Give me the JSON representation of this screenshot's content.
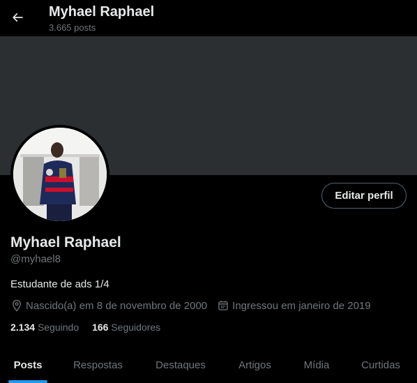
{
  "header": {
    "title": "Myhael Raphael",
    "posts_count": "3.665 posts",
    "back_icon": "arrow-left-icon"
  },
  "profile": {
    "name": "Myhael Raphael",
    "handle": "@myhael8",
    "bio": "Estudante de ads 1/4",
    "birth": "Nascido(a) em 8 de novembro de 2000",
    "joined": "Ingressou em janeiro de 2019",
    "edit_label": "Editar perfil",
    "following_count": "2.134",
    "following_label": "Seguindo",
    "followers_count": "166",
    "followers_label": "Seguidores"
  },
  "tabs": [
    {
      "label": "Posts",
      "active": true
    },
    {
      "label": "Respostas",
      "active": false
    },
    {
      "label": "Destaques",
      "active": false
    },
    {
      "label": "Artigos",
      "active": false
    },
    {
      "label": "Mídia",
      "active": false
    },
    {
      "label": "Curtidas",
      "active": false
    }
  ],
  "colors": {
    "background": "#000000",
    "banner": "#2b2f32",
    "accent": "#1d9bf0",
    "secondary_text": "#71767b",
    "primary_text": "#e7e9ea"
  }
}
